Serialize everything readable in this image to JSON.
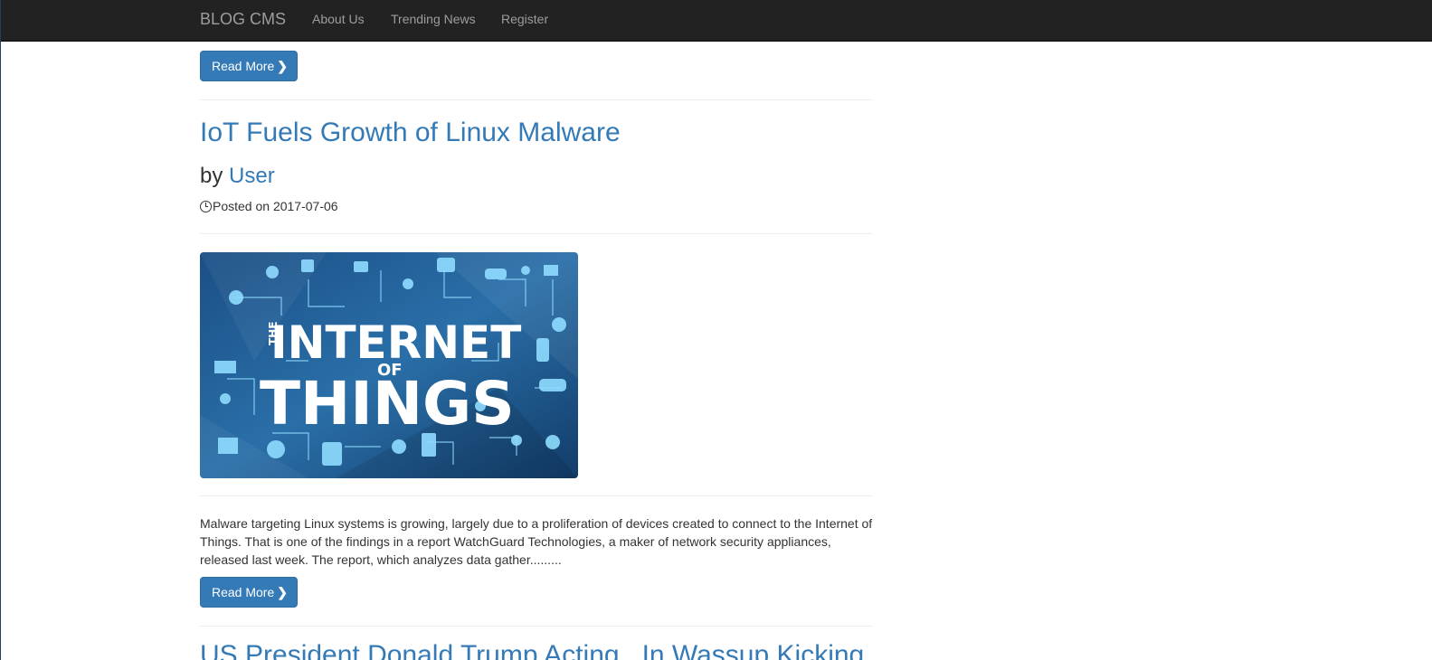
{
  "navbar": {
    "brand": "BLOG CMS",
    "links": [
      "About Us",
      "Trending News",
      "Register"
    ]
  },
  "buttons": {
    "read_more_label": "Read More",
    "read_more_icon": "chevron-right-icon"
  },
  "post": {
    "title": "IoT Fuels Growth of Linux Malware",
    "by_prefix": "by",
    "author": "User",
    "posted": "Posted on 2017-07-06",
    "image": {
      "line1_small": "THE",
      "line1": "INTERNET",
      "line2": "OF",
      "line3": "THINGS"
    },
    "excerpt": "Malware targeting Linux systems is growing, largely due to a proliferation of devices created to connect to the Internet of Things. That is one of the findings in a report WatchGuard Technologies, a maker of network security appliances, released last week. The report, which analyzes data gather........."
  },
  "next_post": {
    "title_partial": "US President Donald Trump Acting...In Wassup Kicking"
  },
  "colors": {
    "navbar_bg": "#222222",
    "link": "#337ab7",
    "button": "#337ab7"
  }
}
